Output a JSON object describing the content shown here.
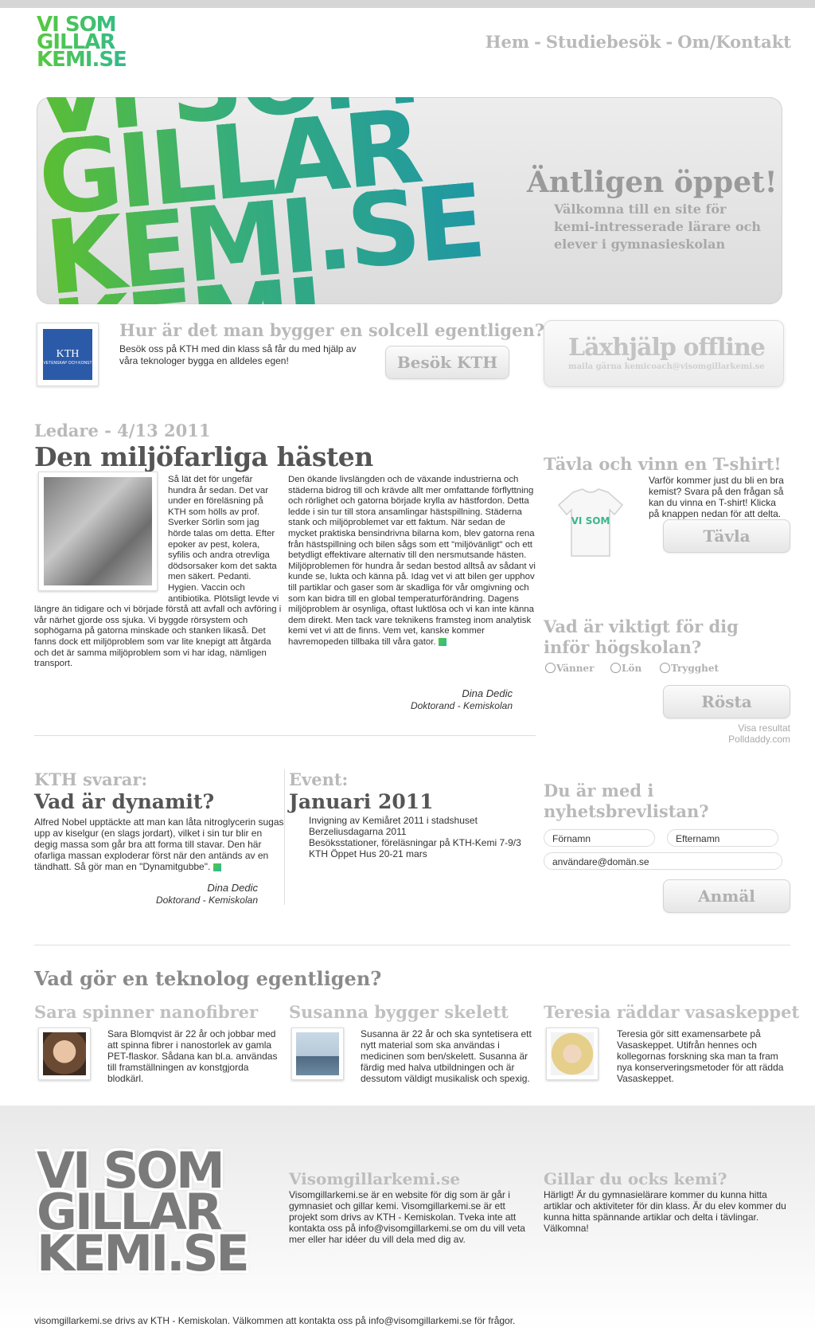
{
  "logo": {
    "lines": [
      "VI SOM",
      "GILLAR",
      "KEMI.SE"
    ]
  },
  "nav": {
    "items": [
      "Hem",
      "Studiebesök",
      "Om/Kontakt"
    ],
    "separator": "-"
  },
  "hero": {
    "lines": [
      "VI SOM",
      "GILLAR",
      "KEMI.SE",
      "KEMI"
    ],
    "title": "Äntligen öppet!",
    "subtitle": "Välkomna till en site för kemi-intresserade lärare och elever i gymnasieskolan"
  },
  "kth_promo": {
    "logo_text": "KTH",
    "logo_sub": "VETENSKAP OCH KONST",
    "heading": "Hur är det man bygger en solcell egentligen?",
    "text": "Besök oss på KTH med din klass så får du med hjälp av våra teknologer bygga en alldeles egen!",
    "button": "Besök KTH"
  },
  "laxhjalp": {
    "title": "Läxhjälp offline",
    "subtitle": "maila gärna kemicoach@visomgillarkemi.se"
  },
  "editorial": {
    "kicker": "Ledare - 4/13 2011",
    "title": "Den miljöfarliga hästen",
    "col1": "Så lät det för ungefär hundra år sedan. Det var under en föreläsning på KTH som hölls av prof. Sverker Sörlin som jag hörde talas om detta. Efter epoker av pest, kolera, syfilis och andra otrevliga dödsorsaker kom det sakta men säkert. Pedanti. Hygien. Vaccin och antibiotika. Plötsligt levde vi längre än tidigare och vi började förstå att avfall och avföring i vår närhet gjorde oss sjuka. Vi byggde rörsystem och sophögarna på gatorna minskade och stanken likaså. Det fanns dock ett miljöproblem som var lite knepigt att åtgärda och det är samma miljöproblem som vi har idag, nämligen transport.",
    "col2": "Den ökande livslängden och de växande industrierna och städerna bidrog till och krävde allt mer omfattande förflyttning och rörlighet och gatorna började krylla av hästfordon. Detta ledde i sin tur till stora ansamlingar hästspillning. Städerna stank och miljöproblemet var ett faktum. När sedan de mycket praktiska bensindrivna bilarna kom, blev gatorna rena från hästspillning och bilen sågs som ett \"miljövänligt\" och ett betydligt effektivare alternativ till den nersmutsande hästen. Miljöproblemen för hundra år sedan bestod alltså av sådant vi kunde se, lukta och känna på. Idag vet vi att bilen ger upphov till partiklar och gaser som är skadliga för vår omgivning och som kan bidra till en global temperaturförändring. Dagens miljöproblem är osynliga, oftast luktlösa och vi kan inte känna dem direkt. Men tack vare teknikens framsteg inom analytisk kemi vet vi att de finns. Vem vet, kanske kommer havremopeden tillbaka till våra gator.",
    "author": "Dina Dedic",
    "role": "Doktorand - Kemiskolan"
  },
  "contest": {
    "heading": "Tävla och vinn en T-shirt!",
    "shirt_text": "VI SOM",
    "text": "Varför kommer just du bli en bra kemist? Svara på den frågan så kan du vinna en T-shirt! Klicka på knappen nedan för att delta.",
    "button": "Tävla"
  },
  "poll": {
    "heading": "Vad är viktigt för dig inför högskolan?",
    "options": [
      "Vänner",
      "Lön",
      "Trygghet"
    ],
    "button": "Rösta",
    "results_link": "Visa resultat",
    "provider": "Polldaddy.com"
  },
  "kth_answers": {
    "kicker": "KTH svarar:",
    "title": "Vad är dynamit?",
    "text": "Alfred Nobel upptäckte att man kan låta nitroglycerin sugas upp av kiselgur (en slags jordart), vilket i sin tur blir en degig massa som går bra att forma till stavar. Den här ofarliga massan exploderar först när den antänds av en tändhatt. Så gör man en \"Dynamitgubbe\".",
    "author": "Dina Dedic",
    "role": "Doktorand - Kemiskolan"
  },
  "event": {
    "kicker": "Event:",
    "title": "Januari 2011",
    "items": [
      "Invigning av Kemiåret 2011 i stadshuset",
      "Berzeliusdagarna 2011",
      "Besöksstationer, föreläsningar på KTH-Kemi 7-9/3",
      "KTH Öppet Hus 20-21 mars"
    ]
  },
  "newsletter": {
    "heading": "Du är med i nyhetsbrevlistan?",
    "first_name": "Förnamn",
    "last_name": "Efternamn",
    "email": "användare@domän.se",
    "button": "Anmäl"
  },
  "teknolog": {
    "heading": "Vad gör en teknolog egentligen?",
    "people": [
      {
        "title": "Sara spinner nanofibrer",
        "text": "Sara Blomqvist är 22 år och jobbar med att spinna fibrer i nanostorlek av gamla PET-flaskor. Sådana kan bl.a. användas till framställningen av konstgjorda blodkärl."
      },
      {
        "title": "Susanna bygger skelett",
        "text": "Susanna är 22 år och ska syntetisera ett nytt material som ska användas i medicinen som ben/skelett. Susanna är färdig med halva utbildningen och är dessutom väldigt musikalisk och spexig."
      },
      {
        "title": "Teresia räddar vasaskeppet",
        "text": "Teresia gör sitt examensarbete på Vasaskeppet. Utifrån hennes och kollegornas forskning ska man ta fram nya konserveringsmetoder för att rädda Vasaskeppet."
      }
    ]
  },
  "footer": {
    "logo_lines": [
      "VI SOM",
      "GILLAR",
      "KEMI.SE"
    ],
    "about_heading": "Visomgillarkemi.se",
    "about_text": "Visomgillarkemi.se är en website för dig som är går i gymnasiet och gillar kemi. Visomgillarkemi.se är ett projekt som drivs av KTH - Kemiskolan. Tveka inte att kontakta oss på info@visomgillarkemi.se om du vill veta mer eller har idéer du vill dela med dig av.",
    "also_heading": "Gillar du ocks kemi?",
    "also_text": "Härligt! Är du gymnasielärare kommer du kunna hitta artiklar och aktiviteter för din klass. Är du elev kommer du kunna hitta spännande artiklar och delta i tävlingar. Välkomna!",
    "bottom": "visomgillarkemi.se drivs av KTH - Kemiskolan. Välkommen att kontakta oss på info@visomgillarkemi.se för frågor."
  },
  "colors": {
    "accent_green": "#56c93f",
    "accent_teal": "#1f97a3",
    "heading_grey": "#b9b9b9"
  }
}
